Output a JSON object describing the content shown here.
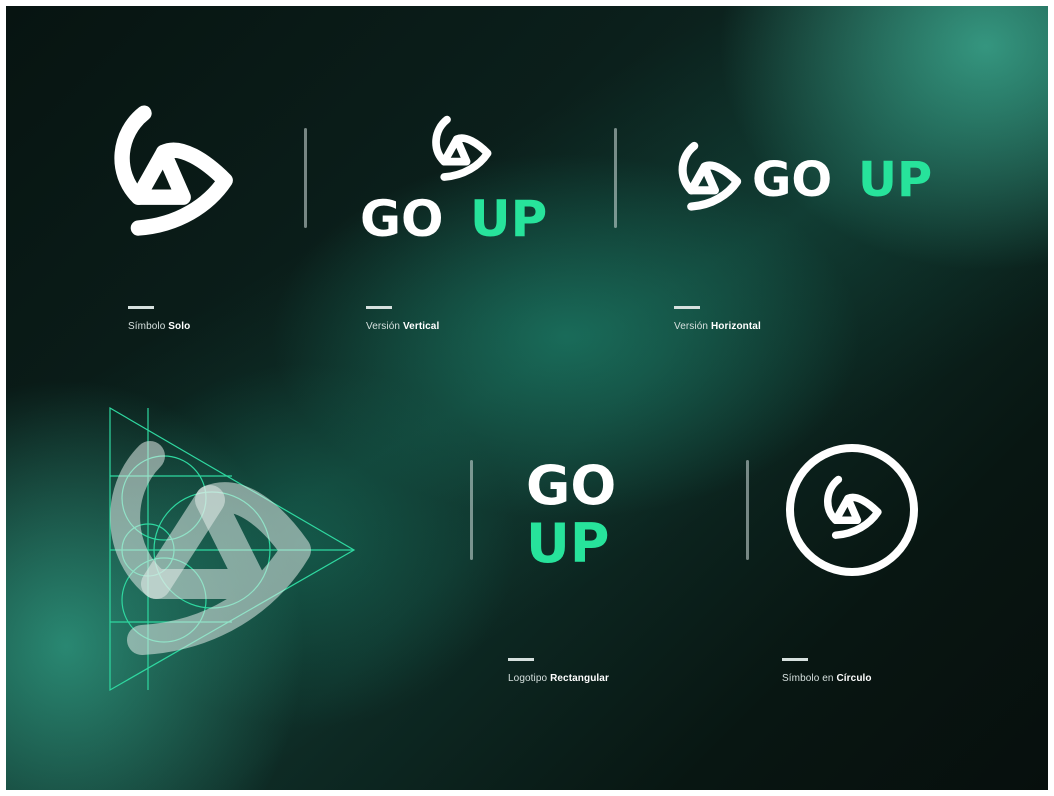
{
  "brand": {
    "go": "GO",
    "up": "UP",
    "colors": {
      "white": "#ffffff",
      "accent": "#27e39b",
      "background": "#0b1f1b",
      "grid_line": "#2fd8a0"
    }
  },
  "icons": {
    "symbol": "triangle-swirl-logo-icon",
    "grid": "construction-grid-icon"
  },
  "captions": [
    {
      "regular": "Símbolo",
      "bold": "Solo"
    },
    {
      "regular": "Versión",
      "bold": "Vertical"
    },
    {
      "regular": "Versión",
      "bold": "Horizontal"
    },
    {
      "regular": "Logotipo",
      "bold": "Rectangular"
    },
    {
      "regular": "Símbolo en",
      "bold": "Círculo"
    }
  ]
}
